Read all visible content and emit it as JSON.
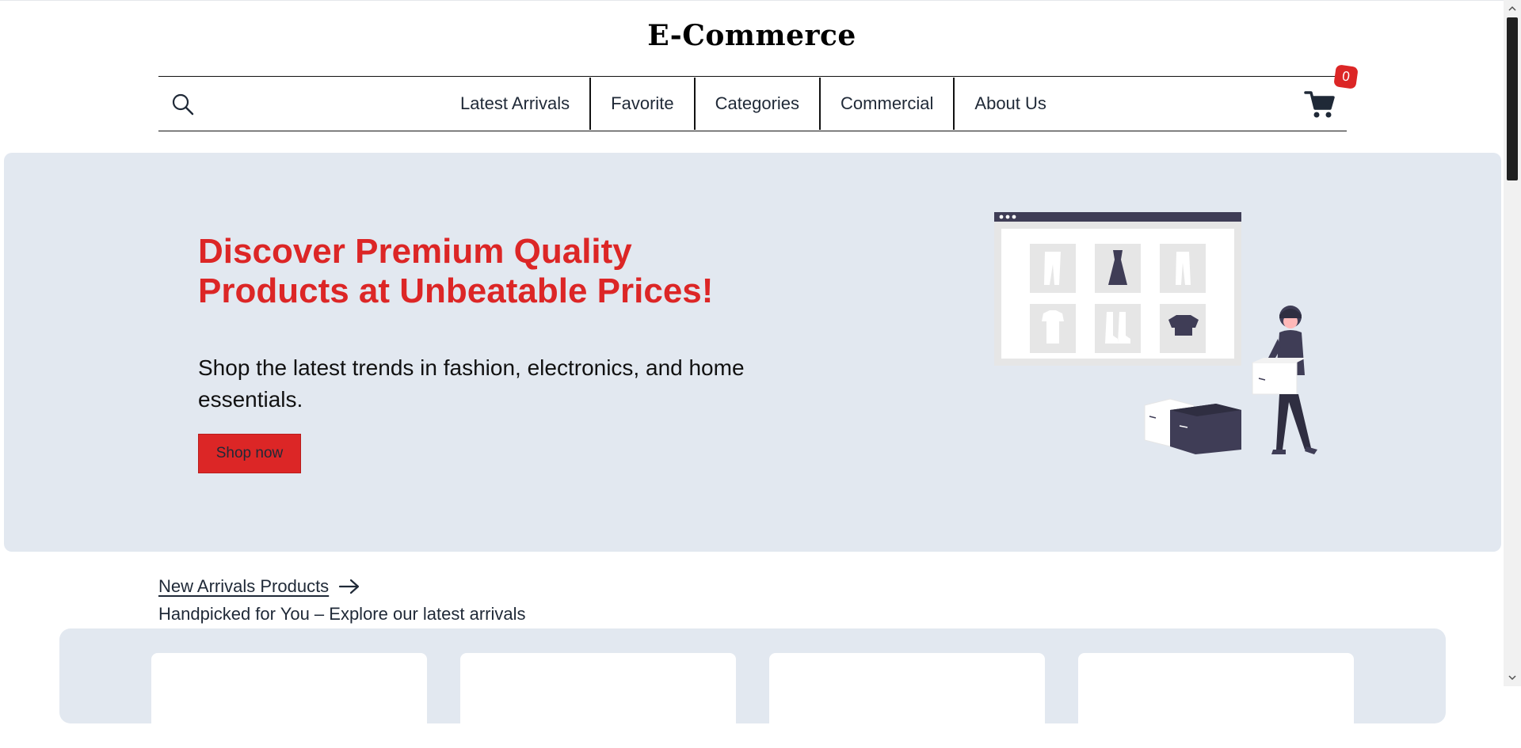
{
  "header": {
    "brand": "E-Commerce"
  },
  "nav": {
    "search_icon": "search-icon",
    "links": [
      "Latest Arrivals",
      "Favorite",
      "Categories",
      "Commercial",
      "About Us"
    ],
    "cart_icon": "cart-icon",
    "cart_count": "0"
  },
  "hero": {
    "title": "Discover Premium Quality Products at Unbeatable Prices!",
    "subtitle": "Shop the latest trends in fashion, electronics, and home essentials.",
    "cta": "Shop now"
  },
  "arrivals": {
    "link_label": "New Arrivals Products",
    "subtitle": "Handpicked for You – Explore our latest arrivals"
  },
  "colors": {
    "accent": "#dc2626",
    "hero_bg": "#e2e8f0",
    "text": "#1f2937"
  }
}
